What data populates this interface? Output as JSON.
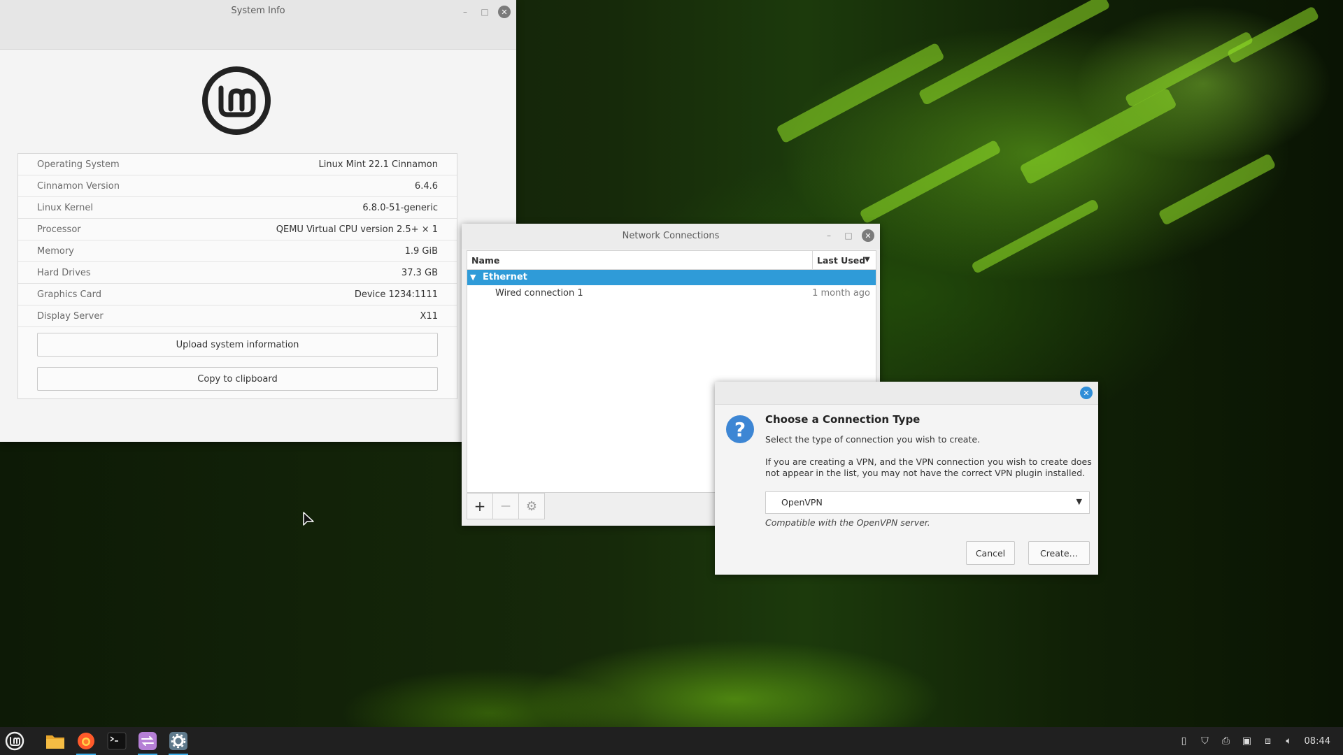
{
  "sysinfo": {
    "title": "System Info",
    "rows": [
      {
        "key": "Operating System",
        "value": "Linux Mint 22.1 Cinnamon"
      },
      {
        "key": "Cinnamon Version",
        "value": "6.4.6"
      },
      {
        "key": "Linux Kernel",
        "value": "6.8.0-51-generic"
      },
      {
        "key": "Processor",
        "value": "QEMU Virtual CPU version 2.5+ × 1"
      },
      {
        "key": "Memory",
        "value": "1.9 GiB"
      },
      {
        "key": "Hard Drives",
        "value": "37.3 GB"
      },
      {
        "key": "Graphics Card",
        "value": "Device 1234:1111"
      },
      {
        "key": "Display Server",
        "value": "X11"
      }
    ],
    "upload_label": "Upload system information",
    "copy_label": "Copy to clipboard"
  },
  "netconn": {
    "title": "Network Connections",
    "col_name": "Name",
    "col_last_used": "Last Used",
    "group": "Ethernet",
    "items": [
      {
        "name": "Wired connection 1",
        "last_used": "1 month ago"
      }
    ],
    "add_symbol": "+",
    "remove_symbol": "—",
    "settings_symbol": "⚙"
  },
  "dialog": {
    "title": "Choose a Connection Type",
    "subtitle": "Select the type of connection you wish to create.",
    "note": "If you are creating a VPN, and the VPN connection you wish to create does not appear in the list, you may not have the correct VPN plugin installed.",
    "selected_type": "OpenVPN",
    "description": "Compatible with the OpenVPN server.",
    "cancel_label": "Cancel",
    "create_label": "Create…"
  },
  "taskbar": {
    "clock": "08:44",
    "apps": [
      "menu-icon",
      "files-icon",
      "firefox-icon",
      "terminal-icon",
      "warpinator-icon",
      "settings-icon"
    ]
  },
  "colors": {
    "accent": "#2f9bd8",
    "taskbar": "#202020",
    "dialog_icon": "#3d86d4"
  }
}
